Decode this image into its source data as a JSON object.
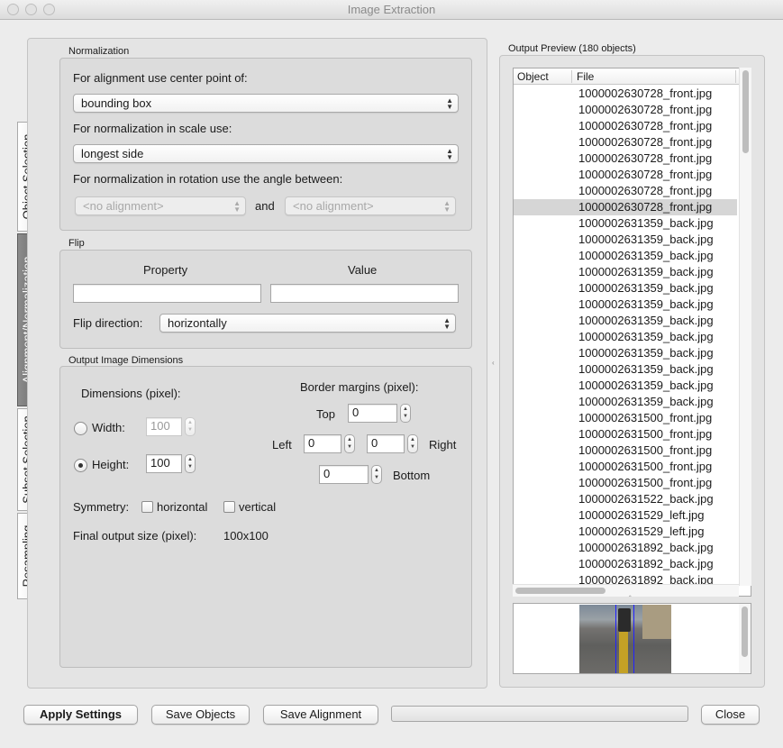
{
  "window": {
    "title": "Image Extraction"
  },
  "tabs": [
    {
      "label": "Object Selection"
    },
    {
      "label": "Alignment/Normalization"
    },
    {
      "label": "Subset Selection"
    },
    {
      "label": "Resampling"
    }
  ],
  "normalization": {
    "group_label": "Normalization",
    "center_label": "For alignment use center point of:",
    "center_value": "bounding box",
    "scale_label": "For normalization in scale use:",
    "scale_value": "longest side",
    "rotation_label": "For normalization in rotation use the angle between:",
    "rotation_a": "<no alignment>",
    "and_label": "and",
    "rotation_b": "<no alignment>"
  },
  "flip": {
    "group_label": "Flip",
    "property_header": "Property",
    "value_header": "Value",
    "property_value": "",
    "value_value": "",
    "direction_label": "Flip direction:",
    "direction_value": "horizontally"
  },
  "dimensions": {
    "group_label": "Output Image Dimensions",
    "dims_label": "Dimensions (pixel):",
    "width_label": "Width:",
    "width_value": "100",
    "height_label": "Height:",
    "height_value": "100",
    "selected": "height",
    "border_label": "Border margins (pixel):",
    "top_label": "Top",
    "top_value": "0",
    "left_label": "Left",
    "left_value": "0",
    "right_value": "0",
    "right_label": "Right",
    "bottom_value": "0",
    "bottom_label": "Bottom",
    "symmetry_label": "Symmetry:",
    "horizontal_label": "horizontal",
    "vertical_label": "vertical",
    "final_label": "Final output size (pixel):",
    "final_value": "100x100"
  },
  "preview": {
    "title": "Output Preview (180 objects)",
    "col_object": "Object",
    "col_file": "File",
    "selected_index": 7,
    "files": [
      "1000002630728_front.jpg",
      "1000002630728_front.jpg",
      "1000002630728_front.jpg",
      "1000002630728_front.jpg",
      "1000002630728_front.jpg",
      "1000002630728_front.jpg",
      "1000002630728_front.jpg",
      "1000002630728_front.jpg",
      "1000002631359_back.jpg",
      "1000002631359_back.jpg",
      "1000002631359_back.jpg",
      "1000002631359_back.jpg",
      "1000002631359_back.jpg",
      "1000002631359_back.jpg",
      "1000002631359_back.jpg",
      "1000002631359_back.jpg",
      "1000002631359_back.jpg",
      "1000002631359_back.jpg",
      "1000002631359_back.jpg",
      "1000002631359_back.jpg",
      "1000002631500_front.jpg",
      "1000002631500_front.jpg",
      "1000002631500_front.jpg",
      "1000002631500_front.jpg",
      "1000002631500_front.jpg",
      "1000002631522_back.jpg",
      "1000002631529_left.jpg",
      "1000002631529_left.jpg",
      "1000002631892_back.jpg",
      "1000002631892_back.jpg",
      "1000002631892_back.jpg"
    ]
  },
  "buttons": {
    "apply": "Apply Settings",
    "save_objects": "Save Objects",
    "save_alignment": "Save Alignment",
    "close": "Close"
  },
  "progress": 0
}
